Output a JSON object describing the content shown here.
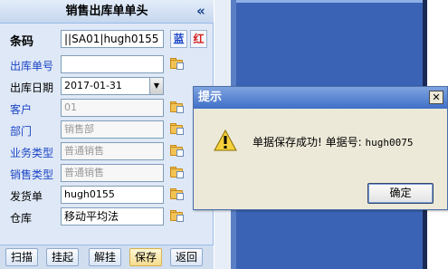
{
  "panel": {
    "title": "销售出库单单头",
    "collapse_icon": "«",
    "barcode": {
      "label": "条码",
      "value": "||SA01|hugh0155",
      "blue_label": "蓝",
      "red_label": "红"
    },
    "fields": [
      {
        "label": "出库单号",
        "value": "",
        "link": true
      },
      {
        "label": "出库日期",
        "value": "2017-01-31",
        "link": false
      },
      {
        "label": "客户",
        "value": "01",
        "link": true
      },
      {
        "label": "部门",
        "value": "销售部",
        "link": true
      },
      {
        "label": "业务类型",
        "value": "普通销售",
        "link": true
      },
      {
        "label": "销售类型",
        "value": "普通销售",
        "link": true
      },
      {
        "label": "发货单",
        "value": "hugh0155",
        "link": false
      },
      {
        "label": "仓库",
        "value": "移动平均法",
        "link": false
      }
    ],
    "toolbar": {
      "scan": "扫描",
      "hold": "挂起",
      "release": "解挂",
      "save": "保存",
      "back": "返回"
    }
  },
  "dialog": {
    "title": "提示",
    "message": "单据保存成功! 单据号: ",
    "doc_no": "hugh0075",
    "ok": "确定",
    "close_icon": "✕"
  },
  "colors": {
    "accent": "#1c47c7",
    "dialog_title": "#3e6fc8",
    "panel_bg": "#dfe8f6",
    "right_bg": "#3b63b5"
  },
  "icons": {
    "date_dropdown": "chevron-down-icon",
    "picker": "folder-picker-icon",
    "warning": "warning-icon"
  }
}
